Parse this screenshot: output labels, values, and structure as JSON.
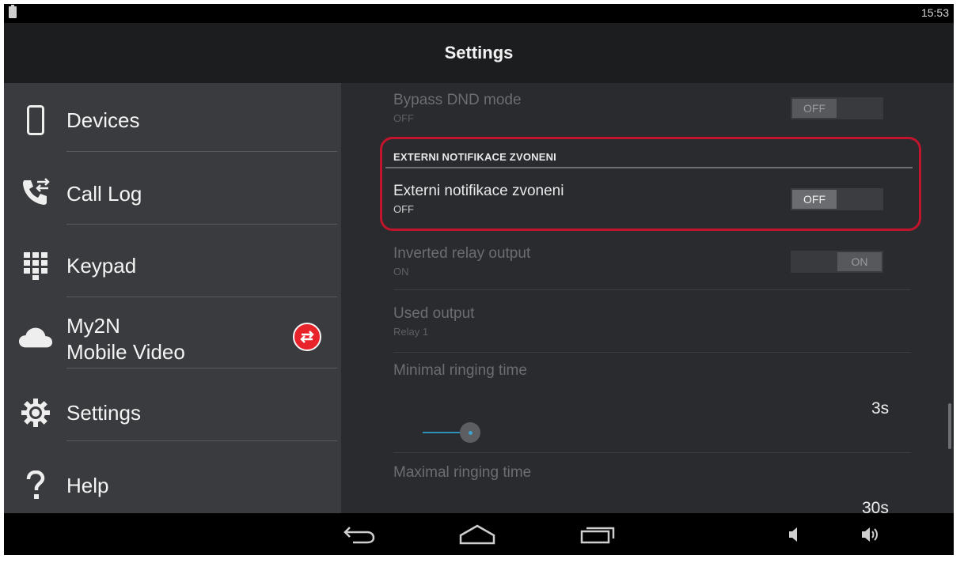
{
  "status_bar": {
    "time": "15:53"
  },
  "action_bar": {
    "title": "Settings"
  },
  "sidebar": {
    "items": [
      {
        "label": "Devices",
        "icon": "phone-icon"
      },
      {
        "label": "Call Log",
        "icon": "call-log-icon"
      },
      {
        "label": "Keypad",
        "icon": "keypad-icon"
      },
      {
        "label_line1": "My2N",
        "label_line2": "Mobile Video",
        "icon": "cloud-icon",
        "badge_icon": "sync-arrows-icon"
      },
      {
        "label": "Settings",
        "icon": "gear-icon"
      },
      {
        "label": "Help",
        "icon": "question-icon"
      }
    ]
  },
  "settings": {
    "bypass_dnd": {
      "title": "Bypass DND mode",
      "summary": "OFF",
      "toggle": "OFF"
    },
    "category": {
      "title": "EXTERNI NOTIFIKACE ZVONENI"
    },
    "ext_notification": {
      "title": "Externi notifikace zvoneni",
      "summary": "OFF",
      "toggle": "OFF"
    },
    "inverted_relay": {
      "title": "Inverted relay output",
      "summary": "ON",
      "toggle": "ON"
    },
    "used_output": {
      "title": "Used output",
      "summary": "Relay 1"
    },
    "min_ringing": {
      "title": "Minimal ringing time",
      "value": "3s",
      "slider_fraction": 0.1
    },
    "max_ringing": {
      "title": "Maximal ringing time",
      "value": "30s"
    }
  },
  "colors": {
    "highlight": "#c0152c",
    "accent": "#3fa3d0",
    "badge": "#e8232a"
  },
  "navigation": {
    "back": "back-icon",
    "home": "home-icon",
    "recents": "recents-icon",
    "volume_down": "volume-down-icon",
    "volume_up": "volume-up-icon"
  }
}
